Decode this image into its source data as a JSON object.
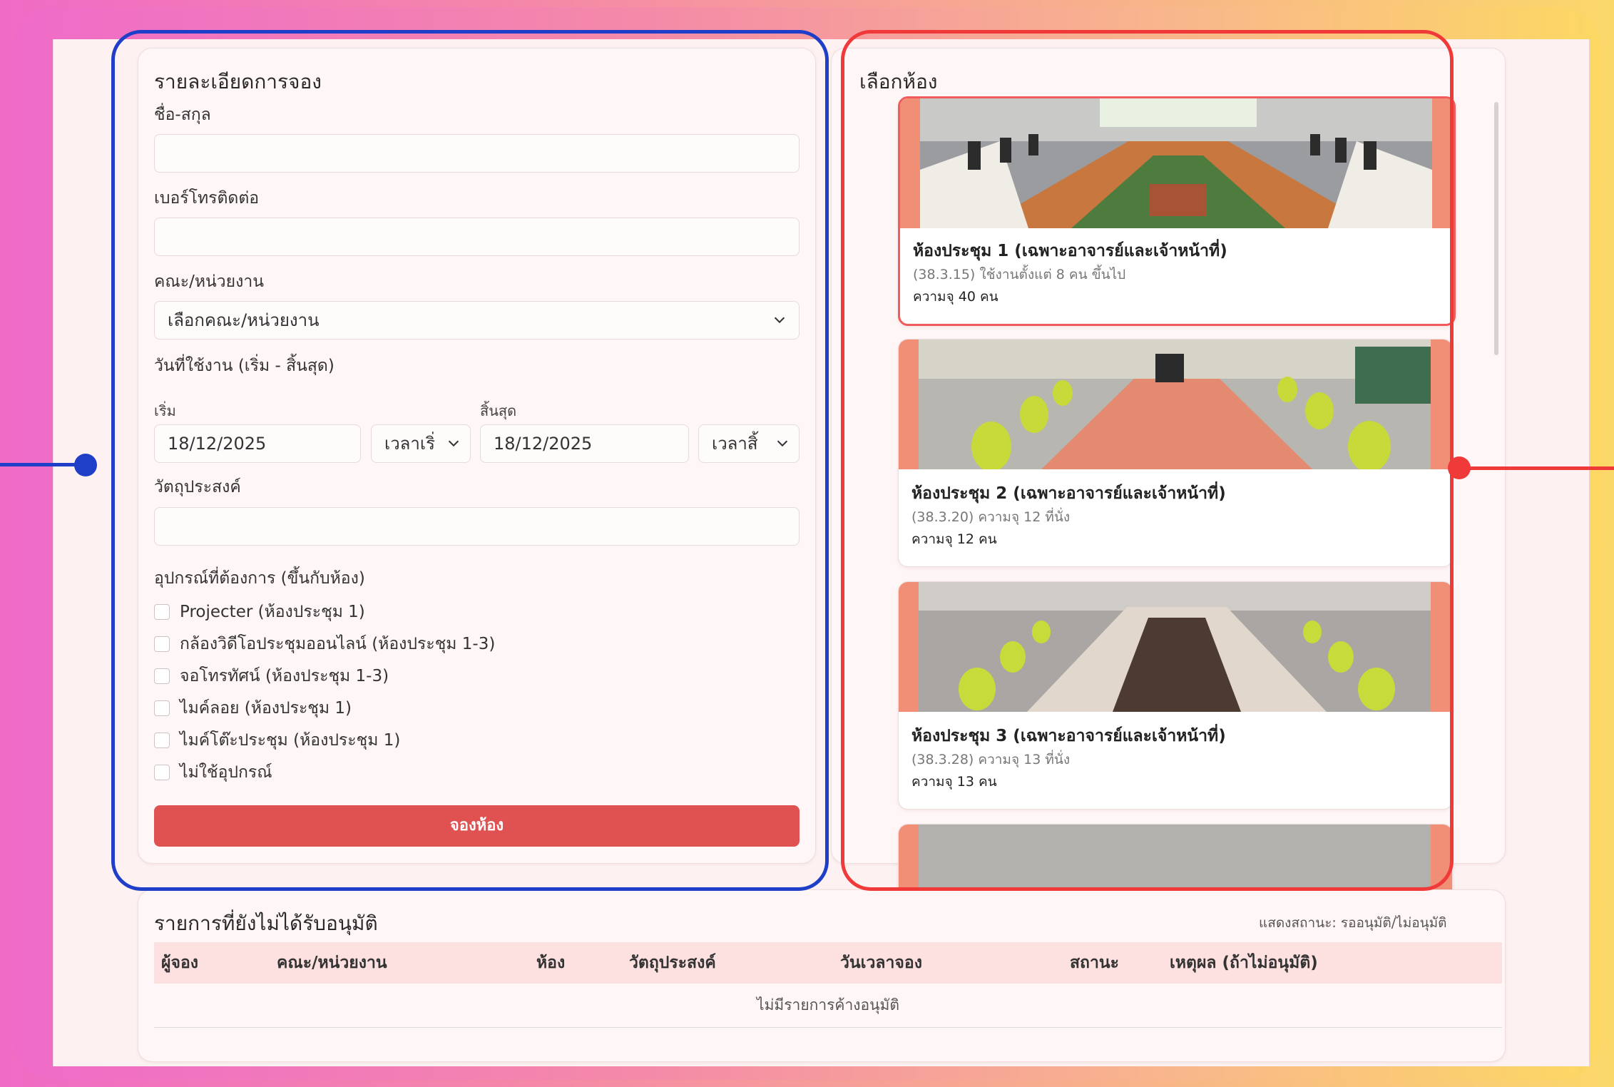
{
  "booking_form": {
    "title": "รายละเอียดการจอง",
    "name_label": "ชื่อ-สกุล",
    "name_value": "",
    "phone_label": "เบอร์โทรติดต่อ",
    "phone_value": "",
    "faculty_label": "คณะ/หน่วยงาน",
    "faculty_selected": "เลือกคณะ/หน่วยงาน",
    "date_range_label": "วันที่ใช้งาน (เริ่ม - สิ้นสุด)",
    "start_label": "เริ่ม",
    "start_date": "18/12/2025",
    "start_time_selected": "เวลาเริ่",
    "end_label": "สิ้นสุด",
    "end_date": "18/12/2025",
    "end_time_selected": "เวลาสิ้",
    "purpose_label": "วัตถุประสงค์",
    "purpose_value": "",
    "equipment_label": "อุปกรณ์ที่ต้องการ (ขึ้นกับห้อง)",
    "equipment": [
      {
        "label": "Projecter (ห้องประชุม 1)",
        "checked": false
      },
      {
        "label": "กล้องวิดีโอประชุมออนไลน์ (ห้องประชุม 1-3)",
        "checked": false
      },
      {
        "label": "จอโทรทัศน์ (ห้องประชุม 1-3)",
        "checked": false
      },
      {
        "label": "ไมค์ลอย (ห้องประชุม 1)",
        "checked": false
      },
      {
        "label": "ไมค์โต๊ะประชุม (ห้องประชุม 1)",
        "checked": false
      },
      {
        "label": "ไม่ใช้อุปกรณ์",
        "checked": false
      }
    ],
    "submit_label": "จองห้อง"
  },
  "room_select": {
    "title": "เลือกห้อง",
    "rooms": [
      {
        "name": "ห้องประชุม 1 (เฉพาะอาจารย์และเจ้าหน้าที่)",
        "desc": "(38.3.15) ใช้งานตั้งแต่ 8 คน ขึ้นไป",
        "capacity": "ความจุ 40 คน",
        "selected": true
      },
      {
        "name": "ห้องประชุม 2 (เฉพาะอาจารย์และเจ้าหน้าที่)",
        "desc": "(38.3.20) ความจุ 12 ที่นั่ง",
        "capacity": "ความจุ 12 คน",
        "selected": false
      },
      {
        "name": "ห้องประชุม 3 (เฉพาะอาจารย์และเจ้าหน้าที่)",
        "desc": "(38.3.28) ความจุ 13 ที่นั่ง",
        "capacity": "ความจุ 13 คน",
        "selected": false
      }
    ]
  },
  "pending": {
    "title": "รายการที่ยังไม่ได้รับอนุมัติ",
    "status_note": "แสดงสถานะ: รออนุมัติ/ไม่อนุมัติ",
    "columns": [
      "ผู้จอง",
      "คณะ/หน่วยงาน",
      "ห้อง",
      "วัตถุประสงค์",
      "วันเวลาจอง",
      "สถานะ",
      "เหตุผล (ถ้าไม่อนุมัติ)"
    ],
    "empty_message": "ไม่มีรายการค้างอนุมัติ"
  },
  "colors": {
    "primary_button": "#e05252",
    "selected_room_border": "#f15b5b",
    "annotation_blue": "#1f3fc9",
    "annotation_red": "#f03a3a",
    "table_header": "#fde0e0"
  }
}
